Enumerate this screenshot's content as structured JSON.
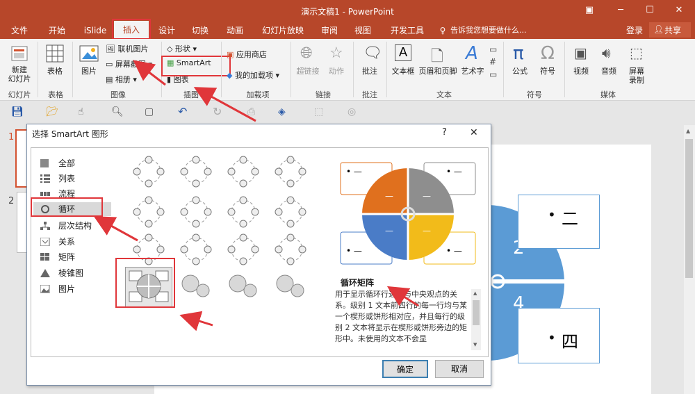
{
  "window": {
    "title": "演示文稿1 - PowerPoint",
    "login": "登录",
    "share": "共享"
  },
  "tabs": [
    "文件",
    "开始",
    "iSlide",
    "插入",
    "设计",
    "切换",
    "动画",
    "幻灯片放映",
    "审阅",
    "视图",
    "开发工具"
  ],
  "active_tab": "插入",
  "tell_me": "告诉我您想要做什么...",
  "ribbon": {
    "new_slide": "新建\n幻灯片",
    "table": "表格",
    "picture": "图片",
    "online_picture": "联机图片",
    "screenshot": "屏幕截图",
    "album": "相册",
    "shapes": "形状",
    "smartart": "SmartArt",
    "chart": "图表",
    "store": "应用商店",
    "my_addins": "我的加载项",
    "hyperlink": "超链接",
    "action": "动作",
    "comment": "批注",
    "textbox": "文本框",
    "header_footer": "页眉和页脚",
    "wordart": "艺术字",
    "equation": "公式",
    "symbol": "符号",
    "video": "视频",
    "audio": "音频",
    "screen_record": "屏幕\n录制",
    "groups": {
      "slides": "幻灯片",
      "tables": "表格",
      "images": "图像",
      "illustrations": "插图",
      "addins": "加载项",
      "links": "链接",
      "comments": "批注",
      "text": "文本",
      "symbols": "符号",
      "media": "媒体"
    }
  },
  "slide_numbers": [
    "1",
    "2"
  ],
  "slide": {
    "labels": [
      "二",
      "四"
    ],
    "numbers": [
      "2",
      "4"
    ]
  },
  "dialog": {
    "title": "选择 SmartArt 图形",
    "help": "?",
    "close": "✕",
    "categories": [
      "全部",
      "列表",
      "流程",
      "循环",
      "层次结构",
      "关系",
      "矩阵",
      "棱锥图",
      "图片"
    ],
    "selected_category": "循环",
    "preview_name": "循环矩阵",
    "preview_bullets": [
      "• —",
      "• —",
      "• —",
      "• —"
    ],
    "description": "用于显示循环行进中与中央观点的关系。级别 1 文本前四行的每一行均与某一个楔形或饼形相对应，并且每行的级别 2 文本将显示在楔形或饼形旁边的矩形中。未使用的文本不会显",
    "ok": "确定",
    "cancel": "取消"
  },
  "colors": {
    "accent": "#b7472a",
    "pie_orange": "#e0701e",
    "pie_gray": "#8e8e8e",
    "pie_blue": "#4a7cc7",
    "pie_yellow": "#f2bb1a",
    "slide_blue": "#5b9bd5",
    "highlight": "#e0363a"
  }
}
